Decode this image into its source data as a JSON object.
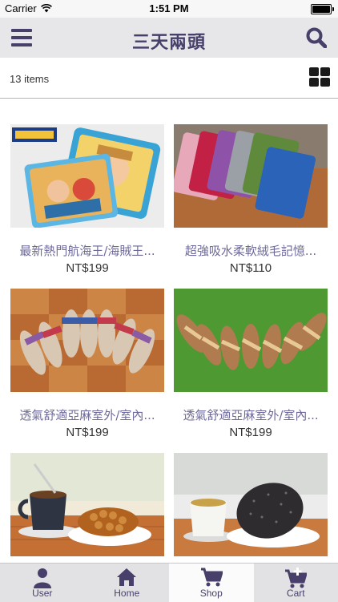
{
  "status_bar": {
    "carrier": "Carrier",
    "time": "1:51 PM"
  },
  "nav": {
    "title": "三天兩頭",
    "menu_icon": "hamburger-menu-icon",
    "search_icon": "search-icon"
  },
  "toolbar": {
    "item_count": "13 items",
    "view_toggle_icon": "grid-view-icon"
  },
  "products": [
    {
      "name": "最新熱門航海王/海賊王...",
      "price": "NT$199"
    },
    {
      "name": "超強吸水柔軟絨毛記憶...",
      "price": "NT$110"
    },
    {
      "name": "透氣舒適亞麻室外/室內...",
      "price": "NT$199"
    },
    {
      "name": "透氣舒適亞麻室外/室內...",
      "price": "NT$199"
    },
    {
      "name": "",
      "price": ""
    },
    {
      "name": "",
      "price": ""
    }
  ],
  "tabs": [
    {
      "label": "User",
      "icon": "user-icon"
    },
    {
      "label": "Home",
      "icon": "home-icon"
    },
    {
      "label": "Shop",
      "icon": "shopping-cart-icon",
      "active": true
    },
    {
      "label": "Cart",
      "icon": "cart-add-icon"
    }
  ],
  "colors": {
    "brand": "#48406a",
    "product_name": "#6e6a9a",
    "navbar_bg": "#e7e7e9",
    "tabbar_bg": "#e2e2e4"
  }
}
